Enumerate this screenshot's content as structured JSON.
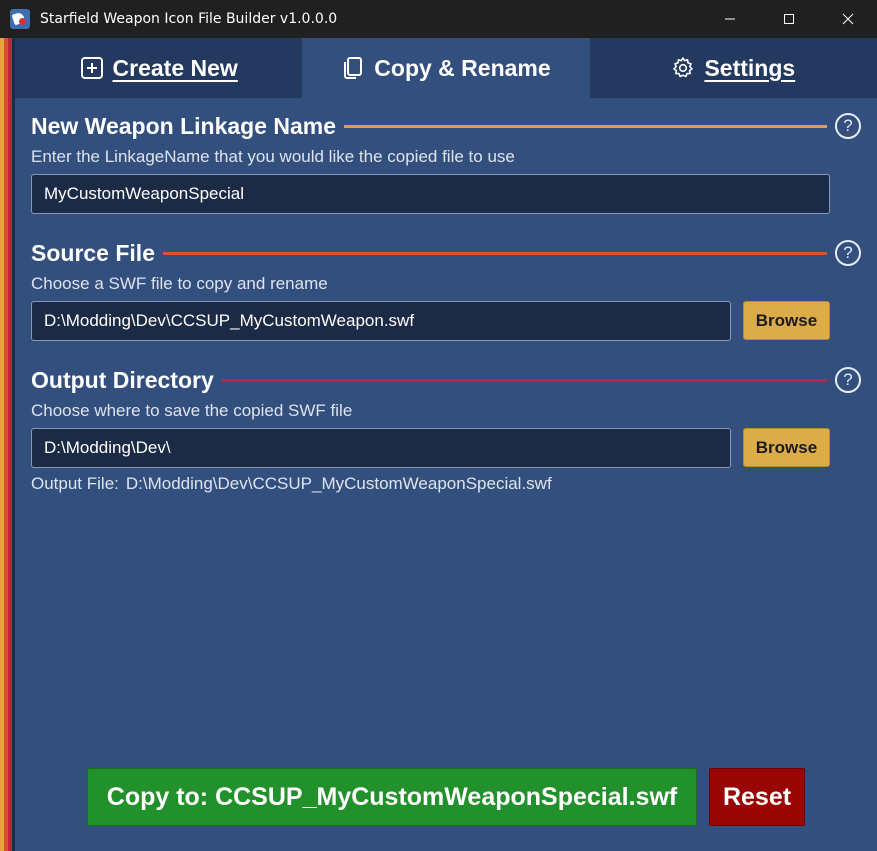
{
  "window": {
    "title": "Starfield Weapon Icon File Builder v1.0.0.0",
    "app_icon": "starfield-app-icon",
    "controls": [
      "minimize-icon",
      "maximize-icon",
      "close-icon"
    ]
  },
  "tabs": [
    {
      "label": "Create New",
      "icon": "plus-square-icon",
      "active": false
    },
    {
      "label": "Copy & Rename",
      "icon": "copy-icon",
      "active": true
    },
    {
      "label": "Settings",
      "icon": "gear-icon",
      "active": false
    }
  ],
  "sections": {
    "linkage": {
      "title": "New Weapon Linkage Name",
      "description": "Enter the LinkageName that you would like the copied file to use",
      "value": "MyCustomWeaponSpecial",
      "line_color": "#d4a251"
    },
    "source": {
      "title": "Source File",
      "description": "Choose a SWF file to copy and rename",
      "value": "D:\\Modding\\Dev\\CCSUP_MyCustomWeapon.swf",
      "browse_label": "Browse",
      "line_color": "#d7532f"
    },
    "output": {
      "title": "Output Directory",
      "description": "Choose where to save the copied SWF file",
      "value": "D:\\Modding\\Dev\\",
      "browse_label": "Browse",
      "line_color": "#c0263a"
    }
  },
  "output_file": {
    "label": "Output File:",
    "value": "D:\\Modding\\Dev\\CCSUP_MyCustomWeaponSpecial.swf"
  },
  "help_icon": "?",
  "actions": {
    "copy_label": "Copy to: CCSUP_MyCustomWeaponSpecial.swf",
    "reset_label": "Reset"
  },
  "colors": {
    "accent_stripes": [
      "#e8a33a",
      "#d7532f",
      "#c0263a"
    ],
    "copy_button": "#23912b",
    "reset_button": "#9a0606",
    "browse_button": "#dcab4a",
    "background": "#334f7d"
  }
}
